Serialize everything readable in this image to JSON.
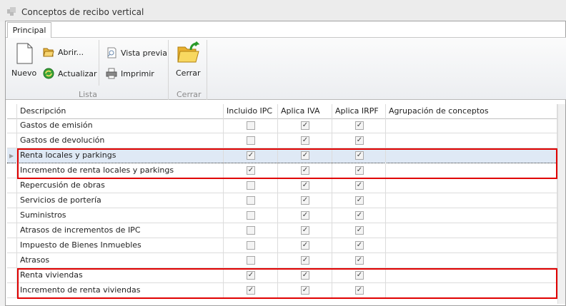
{
  "window": {
    "title": "Conceptos de recibo vertical"
  },
  "ribbon": {
    "tab": "Principal",
    "new": "Nuevo",
    "open": "Abrir...",
    "refresh": "Actualizar",
    "preview": "Vista previa",
    "print": "Imprimir",
    "close": "Cerrar",
    "group_list": "Lista",
    "group_close": "Cerrar"
  },
  "grid": {
    "columns": [
      "Descripción",
      "Incluido IPC",
      "Aplica IVA",
      "Aplica IRPF",
      "Agrupación de conceptos"
    ],
    "rows": [
      {
        "desc": "Gastos de emisión",
        "ipc": false,
        "iva": true,
        "irpf": true,
        "group": ""
      },
      {
        "desc": "Gastos de devolución",
        "ipc": false,
        "iva": true,
        "irpf": true,
        "group": ""
      },
      {
        "desc": "Renta locales y parkings",
        "ipc": true,
        "iva": true,
        "irpf": true,
        "group": "",
        "selected": true
      },
      {
        "desc": "Incremento de renta locales y parkings",
        "ipc": true,
        "iva": true,
        "irpf": true,
        "group": ""
      },
      {
        "desc": "Repercusión de obras",
        "ipc": false,
        "iva": true,
        "irpf": true,
        "group": ""
      },
      {
        "desc": "Servicios de portería",
        "ipc": false,
        "iva": true,
        "irpf": true,
        "group": ""
      },
      {
        "desc": "Suministros",
        "ipc": false,
        "iva": true,
        "irpf": true,
        "group": ""
      },
      {
        "desc": "Atrasos de incrementos de IPC",
        "ipc": false,
        "iva": true,
        "irpf": true,
        "group": ""
      },
      {
        "desc": "Impuesto de Bienes Inmuebles",
        "ipc": false,
        "iva": true,
        "irpf": true,
        "group": ""
      },
      {
        "desc": "Atrasos",
        "ipc": false,
        "iva": true,
        "irpf": true,
        "group": ""
      },
      {
        "desc": "Renta viviendas",
        "ipc": true,
        "iva": true,
        "irpf": true,
        "group": ""
      },
      {
        "desc": "Incremento de renta viviendas",
        "ipc": true,
        "iva": true,
        "irpf": true,
        "group": ""
      }
    ]
  },
  "highlight_color": "#e00000"
}
